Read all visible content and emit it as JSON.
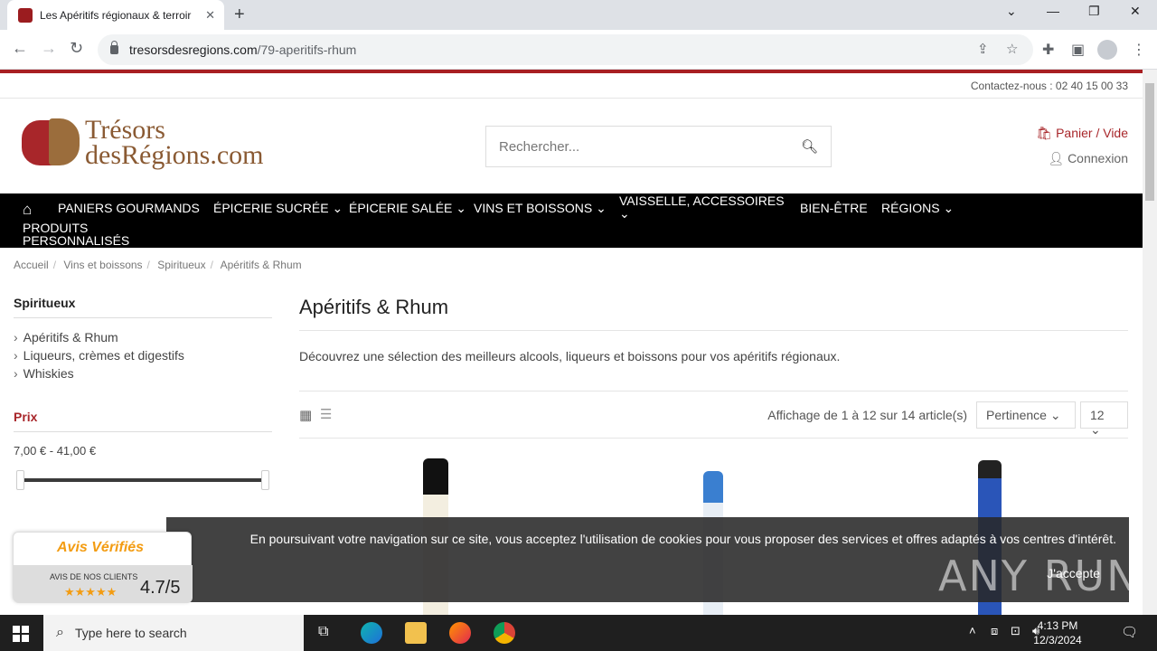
{
  "browser": {
    "tab_title": "Les Apéritifs régionaux & terroir",
    "url_domain": "tresorsdesregions.com",
    "url_path": "/79-aperitifs-rhum"
  },
  "site": {
    "contact": "Contactez-nous : 02 40 15 00 33",
    "logo_line1": "Trésors",
    "logo_line2": "desRégions.com",
    "search_placeholder": "Rechercher...",
    "cart": "Panier / Vide",
    "login": "Connexion"
  },
  "nav": {
    "items": [
      "PANIERS GOURMANDS",
      "ÉPICERIE SUCRÉE",
      "ÉPICERIE SALÉE",
      "VINS ET BOISSONS",
      "VAISSELLE, ACCESSOIRES",
      "BIEN-ÊTRE",
      "RÉGIONS",
      "PRODUITS",
      "PERSONNALISÉS"
    ]
  },
  "breadcrumb": [
    "Accueil",
    "Vins et boissons",
    "Spiritueux",
    "Apéritifs & Rhum"
  ],
  "sidebar": {
    "title": "Spiritueux",
    "items": [
      "Apéritifs & Rhum",
      "Liqueurs, crèmes et digestifs",
      "Whiskies"
    ],
    "price_title": "Prix",
    "price_range": "7,00 € - 41,00 €"
  },
  "content": {
    "title": "Apéritifs & Rhum",
    "description": "Découvrez une sélection des meilleurs alcools, liqueurs et boissons pour vos apéritifs régionaux.",
    "count": "Affichage de 1 à 12 sur 14 article(s)",
    "sort": "Pertinence",
    "per_page": "12"
  },
  "cookie": {
    "text": "En poursuivant votre navigation sur ce site, vous acceptez l'utilisation de cookies pour vous proposer des services et offres adaptés à vos centres d'intérêt.",
    "accept": "J'accepte"
  },
  "avis": {
    "title": "Avis Vérifiés",
    "subtitle": "AVIS DE NOS CLIENTS",
    "stars": "★★★★★",
    "score": "4.7/5"
  },
  "watermark": "ANY RUN",
  "taskbar": {
    "search": "Type here to search",
    "time": "4:13 PM",
    "date": "12/3/2024"
  },
  "colors": {
    "brand_red": "#a8262a",
    "brand_brown": "#8a5a33",
    "nav_bg": "#000000"
  }
}
